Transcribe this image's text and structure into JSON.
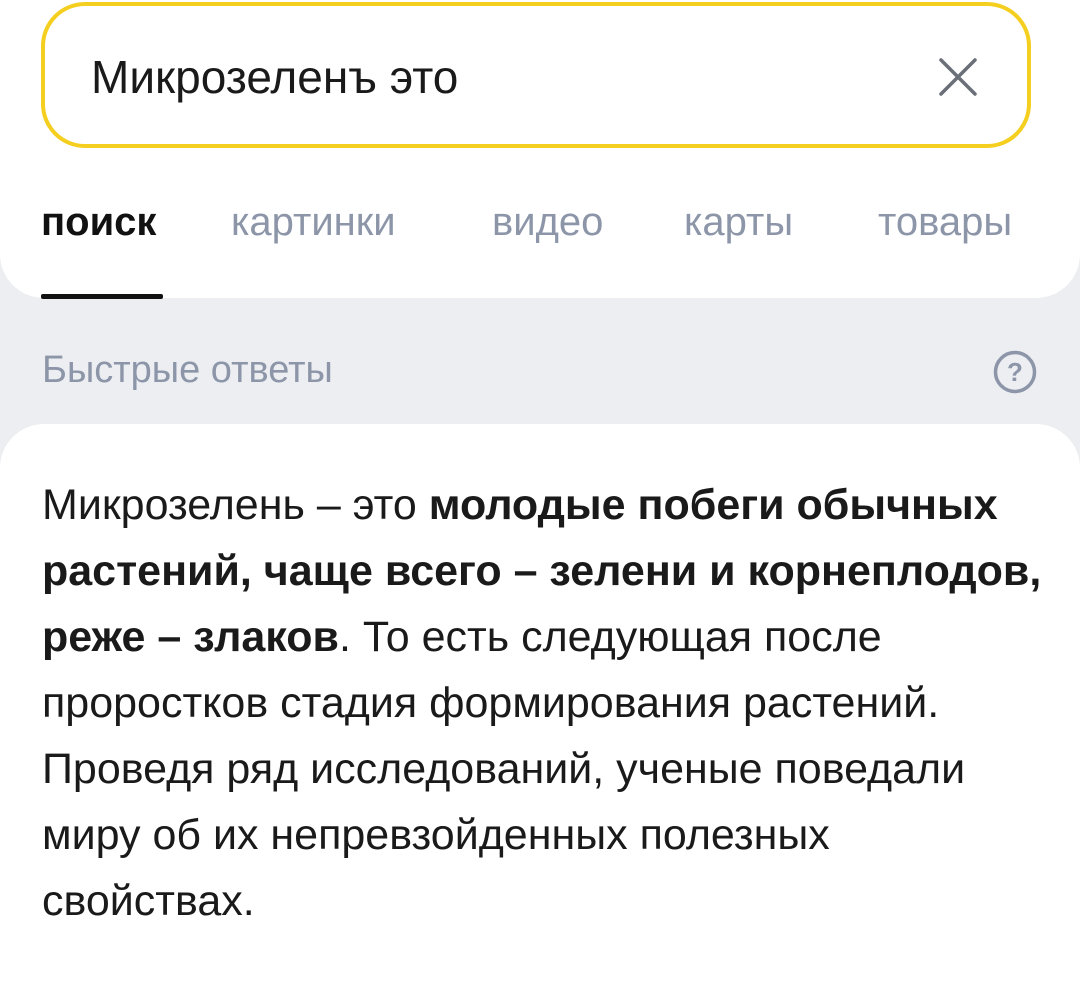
{
  "search": {
    "query": "Микрозеленъ это",
    "clear_icon": "close-icon"
  },
  "tabs": [
    {
      "label": "поиск",
      "active": true
    },
    {
      "label": "картинки",
      "active": false
    },
    {
      "label": "видео",
      "active": false
    },
    {
      "label": "карты",
      "active": false
    },
    {
      "label": "товары",
      "active": false
    }
  ],
  "quick_answers": {
    "header": "Быстрые ответы",
    "help_icon": "question-circle-icon"
  },
  "answer": {
    "lead": "Микрозелень – это ",
    "bold": "молодые побеги обычных растений, чаще всего – зелени и корнеплодов, реже – злаков",
    "rest": ". То есть следующая после проростков стадия формирования растений. Проведя ряд исследований, ученые поведали миру об их непревзойденных полезных свойствах."
  },
  "colors": {
    "search_border": "#f5cf1f",
    "inactive_tab": "#8c96a8",
    "background": "#eceef2"
  }
}
